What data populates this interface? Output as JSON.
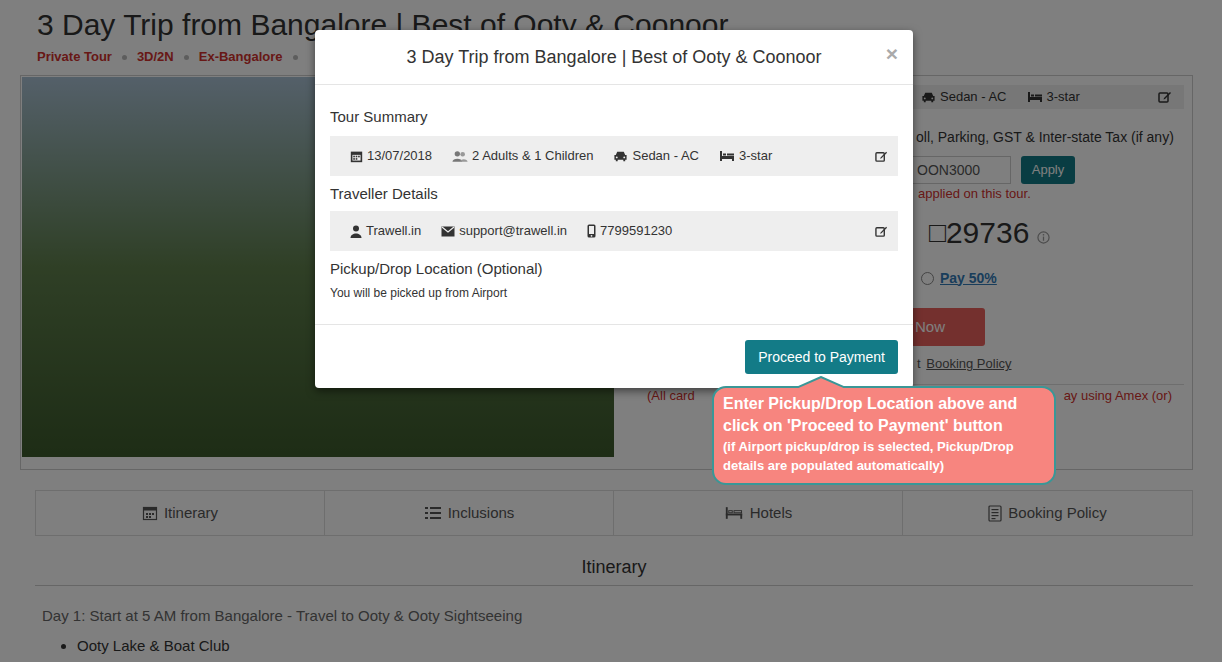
{
  "page": {
    "title": "3 Day Trip from Bangalore | Best of Ooty & Coonoor",
    "tags": [
      "Private Tour",
      "3D/2N",
      "Ex-Bangalore"
    ]
  },
  "booking_panel": {
    "vehicle": "Sedan - AC",
    "hotel": "3-star",
    "note": "oll, Parking, GST & Inter-state Tax (if any)",
    "coupon": {
      "value": "OON3000",
      "button": "Apply",
      "message": "applied on this tour."
    },
    "price": {
      "currency": "□",
      "amount": "29736"
    },
    "payment_option": {
      "label": "Pay 50%",
      "selected": false
    },
    "book_button": "Now",
    "policy": {
      "prefix": "t",
      "link": "Booking Policy"
    },
    "card_note": {
      "start": "(All card",
      "end": "ay using Amex (or)"
    }
  },
  "tabs": [
    "Itinerary",
    "Inclusions",
    "Hotels",
    "Booking Policy"
  ],
  "itinerary": {
    "heading": "Itinerary",
    "day": "Day 1: Start at 5 AM from Bangalore - Travel to Ooty & Ooty Sightseeing",
    "items": [
      "Ooty Lake & Boat Club"
    ]
  },
  "modal": {
    "title": "3 Day Trip from Bangalore | Best of Ooty & Coonoor",
    "close": "×",
    "tour_summary": {
      "label": "Tour Summary",
      "date": "13/07/2018",
      "travellers": "2 Adults & 1 Children",
      "vehicle": "Sedan - AC",
      "hotel": "3-star"
    },
    "traveller_details": {
      "label": "Traveller Details",
      "name": "Trawell.in",
      "email": "support@trawell.in",
      "phone": "7799591230"
    },
    "pickup": {
      "label": "Pickup/Drop Location (Optional)",
      "text": "You will be picked up from Airport"
    },
    "button": "Proceed to Payment"
  },
  "callout": {
    "text": "Enter Pickup/Drop Location above and click on 'Proceed to Payment' button",
    "note": "(if Airport pickup/drop is selected, Pickup/Drop details are populated automatically)"
  }
}
